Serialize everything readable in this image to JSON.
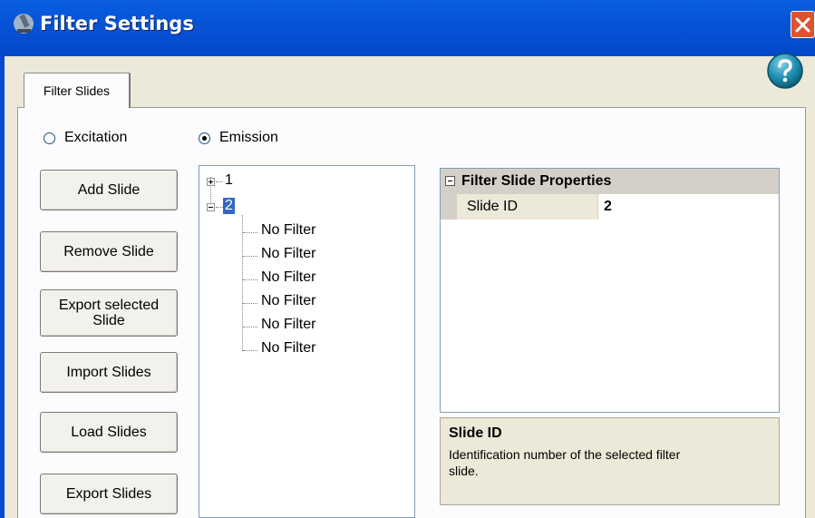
{
  "window": {
    "title": "Filter Settings",
    "icons": {
      "app": "microscope-icon",
      "close": "close-icon",
      "help": "help-icon"
    },
    "colors": {
      "titlebar": "#0653d6",
      "close": "#e0512f",
      "selection": "#316ac5"
    }
  },
  "tabs": [
    {
      "label": "Filter Slides",
      "selected": true
    }
  ],
  "filter_type": {
    "options": [
      {
        "label": "Excitation",
        "checked": false
      },
      {
        "label": "Emission",
        "checked": true
      }
    ]
  },
  "buttons": {
    "add": "Add Slide",
    "remove": "Remove Slide",
    "export_selected_line1": "Export selected",
    "export_selected_line2": "Slide",
    "import": "Import Slides",
    "load": "Load Slides",
    "export": "Export Slides"
  },
  "tree": {
    "nodes": [
      {
        "label": "1",
        "expanded": false
      },
      {
        "label": "2",
        "expanded": true,
        "selected": true,
        "children": [
          "No Filter",
          "No Filter",
          "No Filter",
          "No Filter",
          "No Filter",
          "No Filter"
        ]
      }
    ]
  },
  "property_grid": {
    "category": "Filter Slide Properties",
    "rows": [
      {
        "name": "Slide ID",
        "value": "2"
      }
    ]
  },
  "description": {
    "title": "Slide ID",
    "text_line1": "Identification number of the selected filter",
    "text_line2": "slide."
  }
}
